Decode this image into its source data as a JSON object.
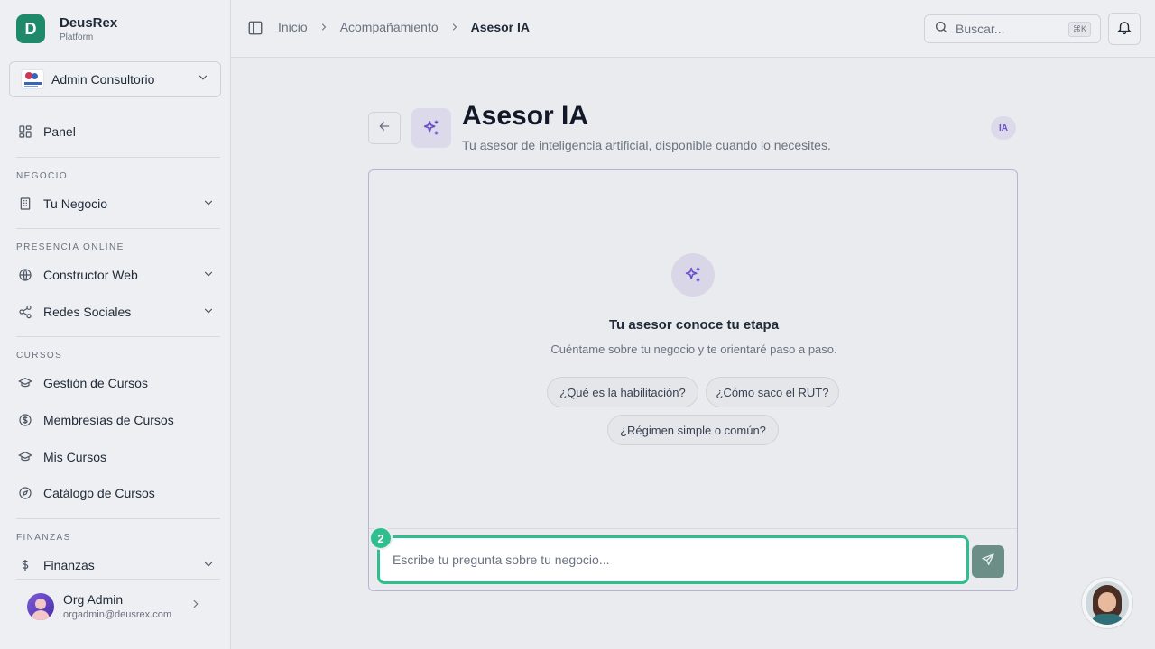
{
  "brand": {
    "initial": "D",
    "name": "DeusRex",
    "subtitle": "Platform"
  },
  "org": {
    "name": "Admin Consultorio"
  },
  "sidebar": {
    "panel": "Panel",
    "sections": {
      "negocio": "NEGOCIO",
      "presencia": "PRESENCIA ONLINE",
      "cursos": "CURSOS",
      "finanzas": "FINANZAS"
    },
    "items": {
      "tu_negocio": "Tu Negocio",
      "constructor_web": "Constructor Web",
      "redes_sociales": "Redes Sociales",
      "gestion_cursos": "Gestión de Cursos",
      "membresias": "Membresías de Cursos",
      "mis_cursos": "Mis Cursos",
      "catalogo": "Catálogo de Cursos",
      "finanzas": "Finanzas"
    }
  },
  "user": {
    "name": "Org Admin",
    "email": "orgadmin@deusrex.com"
  },
  "breadcrumb": {
    "home": "Inicio",
    "parent": "Acompañamiento",
    "current": "Asesor IA"
  },
  "search": {
    "placeholder": "Buscar...",
    "shortcut": "⌘K"
  },
  "page": {
    "title": "Asesor IA",
    "subtitle": "Tu asesor de inteligencia artificial, disponible cuando lo necesites.",
    "badge": "IA"
  },
  "chat": {
    "empty_title": "Tu asesor conoce tu etapa",
    "empty_subtitle": "Cuéntame sobre tu negocio y te orientaré paso a paso.",
    "suggestions": [
      "¿Qué es la habilitación?",
      "¿Cómo saco el RUT?",
      "¿Régimen simple o común?"
    ],
    "input_placeholder": "Escribe tu pregunta sobre tu negocio...",
    "step_badge": "2"
  },
  "colors": {
    "brand": "#1f8a6a",
    "accent": "#2fbf8f",
    "ai_purple": "#6b4fc8"
  }
}
